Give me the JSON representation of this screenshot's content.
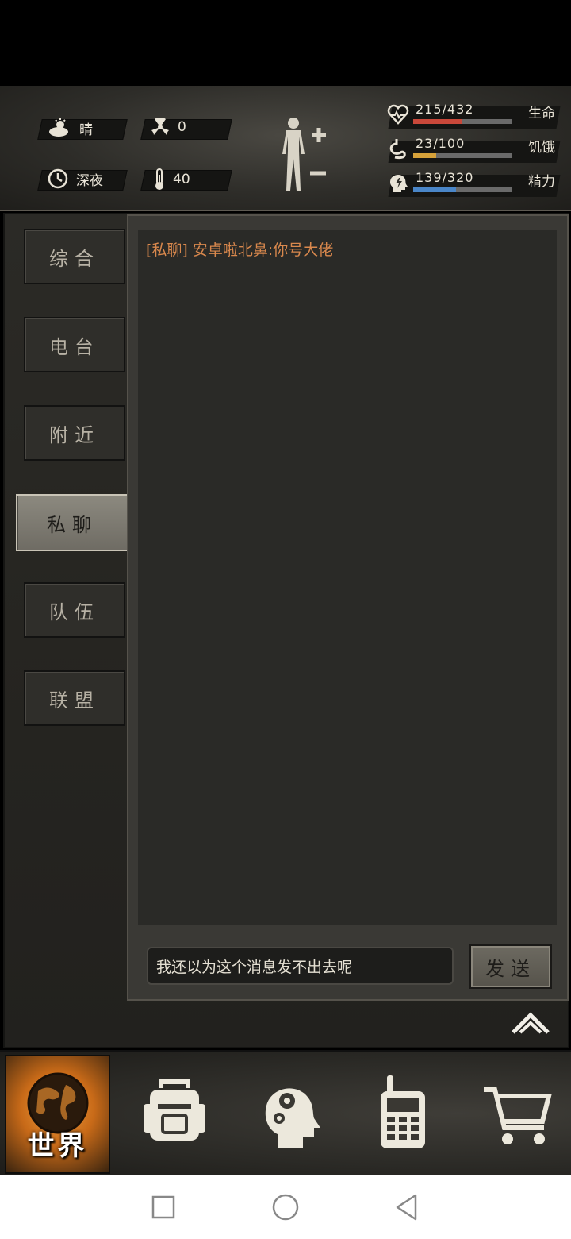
{
  "hud": {
    "weather": "晴",
    "radiation": "0",
    "time_of_day": "深夜",
    "temperature": "40",
    "stats": [
      {
        "name": "生命",
        "value": "215/432",
        "fraction": 0.4977,
        "color": "#c9483a",
        "icon": "heart-icon"
      },
      {
        "name": "饥饿",
        "value": "23/100",
        "fraction": 0.23,
        "color": "#d7a23a",
        "icon": "stomach-icon"
      },
      {
        "name": "精力",
        "value": "139/320",
        "fraction": 0.434,
        "color": "#4a86c8",
        "icon": "energy-head-icon"
      }
    ]
  },
  "tabs": [
    {
      "label": "综合",
      "active": false
    },
    {
      "label": "电台",
      "active": false
    },
    {
      "label": "附近",
      "active": false
    },
    {
      "label": "私聊",
      "active": true
    },
    {
      "label": "队伍",
      "active": false
    },
    {
      "label": "联盟",
      "active": false
    }
  ],
  "messages": [
    {
      "channel": "[私聊]",
      "sender": "安卓啦北鼻",
      "text": ":你号大佬"
    }
  ],
  "input": {
    "value": "我还以为这个消息发不出去呢"
  },
  "send_label": "发送",
  "bottom_nav": {
    "world_label": "世界"
  }
}
